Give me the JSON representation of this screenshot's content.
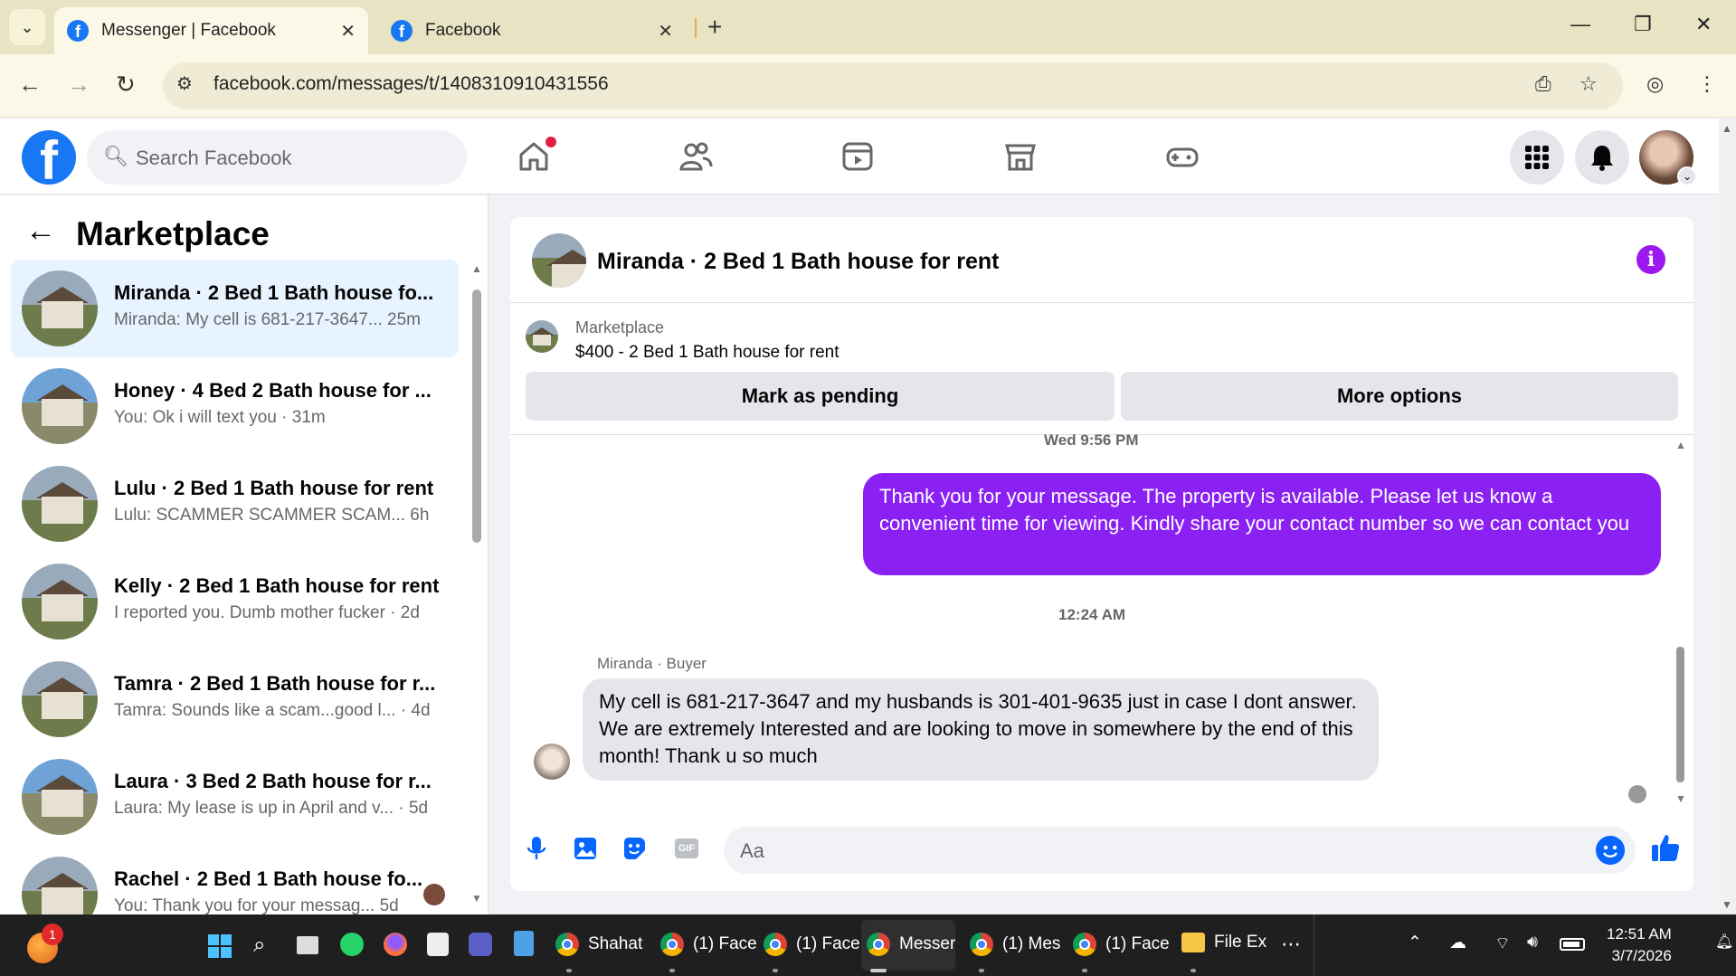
{
  "browser": {
    "tabs": [
      {
        "title": "Messenger | Facebook",
        "active": true
      },
      {
        "title": "Facebook",
        "active": false
      }
    ],
    "url": "facebook.com/messages/t/1408310910431556"
  },
  "fb": {
    "logo": "f",
    "search_placeholder": "Search Facebook"
  },
  "left": {
    "title": "Marketplace",
    "conversations": [
      {
        "name": "Miranda · 2 Bed 1 Bath house fo...",
        "preview": "Miranda: My cell is 681-217-3647... 25m"
      },
      {
        "name": "Honey · 4 Bed 2 Bath house for ...",
        "preview": "You: Ok i will text you · 31m"
      },
      {
        "name": "Lulu · 2 Bed 1 Bath house for rent",
        "preview": "Lulu: SCAMMER SCAMMER SCAM...     6h"
      },
      {
        "name": "Kelly · 2 Bed 1 Bath house for rent",
        "preview": "I reported you. Dumb mother fucker · 2d"
      },
      {
        "name": "Tamra · 2 Bed 1 Bath house for r...",
        "preview": "Tamra: Sounds like a scam...good l...  · 4d"
      },
      {
        "name": "Laura · 3 Bed 2 Bath house for r...",
        "preview": "Laura: My lease is up in April and v...  · 5d"
      },
      {
        "name": "Rachel · 2 Bed 1 Bath house fo...",
        "preview": "You: Thank you for your messag...   5d"
      }
    ]
  },
  "chat": {
    "title": "Miranda · 2 Bed 1 Bath house for rent",
    "listing_label": "Marketplace",
    "listing": "$400 - 2 Bed 1 Bath house for rent",
    "mark_pending": "Mark as pending",
    "more_options": "More options",
    "time1": "Wed 9:56 PM",
    "outgoing": "Thank you for your message. The property is available. Please let us know a convenient time for viewing. Kindly share your contact number so we can contact you",
    "time2": "12:24 AM",
    "sender": "Miranda · Buyer",
    "incoming": "My cell is 681-217-3647 and my husbands is 301-401-9635 just in case I dont answer. We are extremely Interested and are looking to move in somewhere by the end of this month! Thank u so much",
    "composer_placeholder": "Aa",
    "gif": "GIF"
  },
  "taskbar": {
    "items": [
      "Shahat",
      "(1) Face",
      "(1) Face",
      "Messer",
      "(1) Mes",
      "(1) Face",
      "File Ex"
    ],
    "badge": "1",
    "time": "12:51 AM",
    "date": "3/7/2026"
  }
}
